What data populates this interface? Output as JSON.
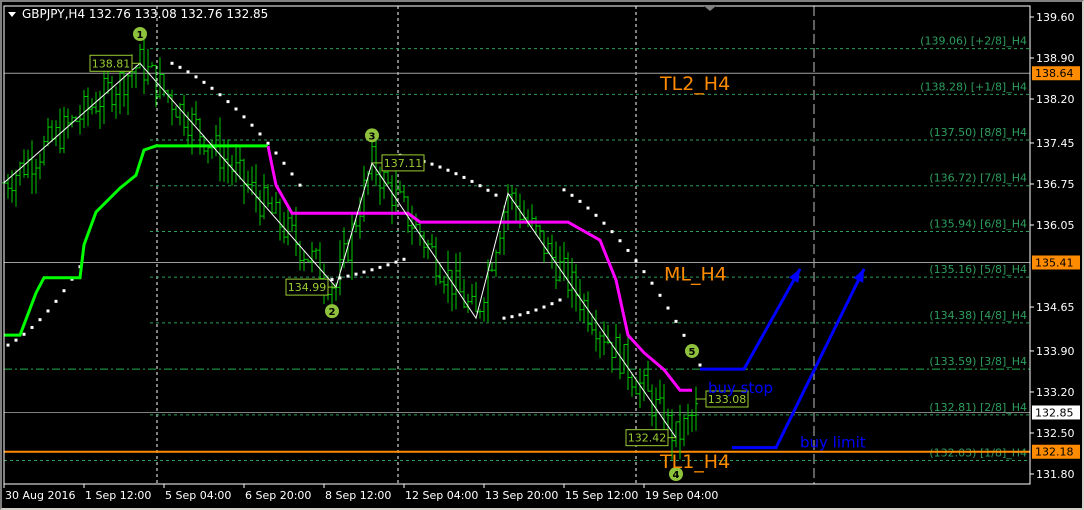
{
  "chart_data": {
    "type": "ohlc",
    "title": "GBPJPY,H4",
    "ohlc_header": "132.76 133.08 132.76 132.85",
    "ylim": [
      131.8,
      139.6
    ],
    "y_ticks": [
      "139.60",
      "138.90",
      "138.20",
      "137.45",
      "136.75",
      "136.05",
      "134.65",
      "133.90",
      "133.20",
      "132.50",
      "131.80"
    ],
    "x_ticks": [
      "30 Aug 2016",
      "1 Sep 12:00",
      "5 Sep 04:00",
      "6 Sep 20:00",
      "8 Sep 12:00",
      "12 Sep 04:00",
      "13 Sep 20:00",
      "15 Sep 12:00",
      "19 Sep 04:00"
    ],
    "x_tick_step_bars": 20,
    "bar_count": 174,
    "price_tags": [
      {
        "value": "138.64",
        "price": 138.64,
        "color": "#ff8c00"
      },
      {
        "value": "135.41",
        "price": 135.41,
        "color": "#ff8c00"
      },
      {
        "value": "132.85",
        "price": 132.85,
        "color": "#ffffff"
      },
      {
        "value": "132.18",
        "price": 132.18,
        "color": "#ff8c00"
      }
    ],
    "murrey_levels": [
      {
        "label": "(139.06) [+2/8]_H4",
        "price": 139.06
      },
      {
        "label": "(138.28) [+1/8]_H4",
        "price": 138.28
      },
      {
        "label": "(137.50) [8/8]_H4",
        "price": 137.5
      },
      {
        "label": "(136.72) [7/8]_H4",
        "price": 136.72
      },
      {
        "label": "(135.94) [6/8]_H4",
        "price": 135.94
      },
      {
        "label": "(135.16) [5/8]_H4",
        "price": 135.16
      },
      {
        "label": "(134.38) [4/8]_H4",
        "price": 134.38
      },
      {
        "label": "(133.59) [3/8]_H4",
        "price": 133.59
      },
      {
        "label": "(132.81) [2/8]_H4",
        "price": 132.81
      },
      {
        "label": "(132.03) [1/8]_H4",
        "price": 132.03
      }
    ],
    "zigzag": [
      [
        0,
        136.77
      ],
      [
        34,
        138.81
      ],
      [
        83,
        134.99
      ],
      [
        92,
        137.11
      ],
      [
        118,
        134.46
      ],
      [
        126,
        136.59
      ],
      [
        168,
        132.42
      ],
      [
        173,
        132.85
      ]
    ],
    "zigzag_labels": [
      {
        "text": "138.81",
        "bar": 34,
        "price": 138.81,
        "side": "left"
      },
      {
        "text": "134.99",
        "bar": 83,
        "price": 134.99,
        "side": "left"
      },
      {
        "text": "137.11",
        "bar": 92,
        "price": 137.11,
        "side": "right"
      },
      {
        "text": "132.42",
        "bar": 168,
        "price": 132.42,
        "side": "left"
      },
      {
        "text": "133.08",
        "bar": 173,
        "price": 133.08,
        "side": "right"
      }
    ],
    "wave_points": [
      {
        "text": "1",
        "bar": 34,
        "price": 139.31
      },
      {
        "text": "2",
        "bar": 82,
        "price": 134.58
      },
      {
        "text": "3",
        "bar": 92,
        "price": 137.58
      },
      {
        "text": "5",
        "bar": 172,
        "price": 133.9
      },
      {
        "text": "4",
        "bar": 168,
        "price": 131.8
      }
    ],
    "moving_average": {
      "up_color": "#00ff00",
      "down_color": "#ff00ff",
      "switch_bar": 66,
      "points": [
        [
          0,
          134.17
        ],
        [
          4,
          134.17
        ],
        [
          8,
          134.89
        ],
        [
          10,
          135.15
        ],
        [
          19,
          135.15
        ],
        [
          20,
          135.71
        ],
        [
          23,
          136.27
        ],
        [
          29,
          136.68
        ],
        [
          33,
          136.9
        ],
        [
          35,
          137.33
        ],
        [
          38,
          137.4
        ],
        [
          66,
          137.4
        ],
        [
          68,
          136.73
        ],
        [
          72,
          136.25
        ],
        [
          101,
          136.25
        ],
        [
          104,
          136.1
        ],
        [
          141,
          136.1
        ],
        [
          149,
          135.79
        ],
        [
          153,
          135.11
        ],
        [
          156,
          134.17
        ],
        [
          160,
          133.87
        ],
        [
          165,
          133.58
        ],
        [
          169,
          133.23
        ],
        [
          172,
          133.23
        ]
      ]
    },
    "parabolic_sar": [
      [
        [
          1,
          134.0
        ],
        [
          20,
          135.45
        ]
      ],
      [
        [
          42,
          138.81
        ],
        [
          74,
          136.73
        ]
      ],
      [
        [
          74,
          135.03
        ],
        [
          101,
          135.49
        ]
      ],
      [
        [
          99,
          137.24
        ],
        [
          123,
          136.56
        ]
      ],
      [
        [
          125,
          134.46
        ],
        [
          139,
          134.77
        ]
      ],
      [
        [
          140,
          136.65
        ],
        [
          174,
          133.66
        ]
      ]
    ],
    "text_objects": [
      {
        "text": "TL2_H4",
        "bar": 164,
        "price": 138.35,
        "color": "#ff8c00"
      },
      {
        "text": "ML_H4",
        "bar": 165,
        "price": 135.1,
        "color": "#ff8c00"
      },
      {
        "text": "TL1_H4",
        "bar": 164,
        "price": 131.9,
        "color": "#ff8c00"
      },
      {
        "text": "buy stop",
        "bar": 176,
        "price": 133.18,
        "color": "#0000ff"
      },
      {
        "text": "buy limit",
        "bar": 199,
        "price": 132.25,
        "color": "#0000ff"
      }
    ],
    "arrows": [
      {
        "name": "buy-stop-arrow",
        "points": [
          [
            174,
            133.59
          ],
          [
            185,
            133.59
          ],
          [
            199,
            135.3
          ]
        ]
      },
      {
        "name": "buy-limit-arrow",
        "points": [
          [
            182,
            132.25
          ],
          [
            193,
            132.25
          ],
          [
            215,
            135.3
          ]
        ]
      }
    ]
  }
}
